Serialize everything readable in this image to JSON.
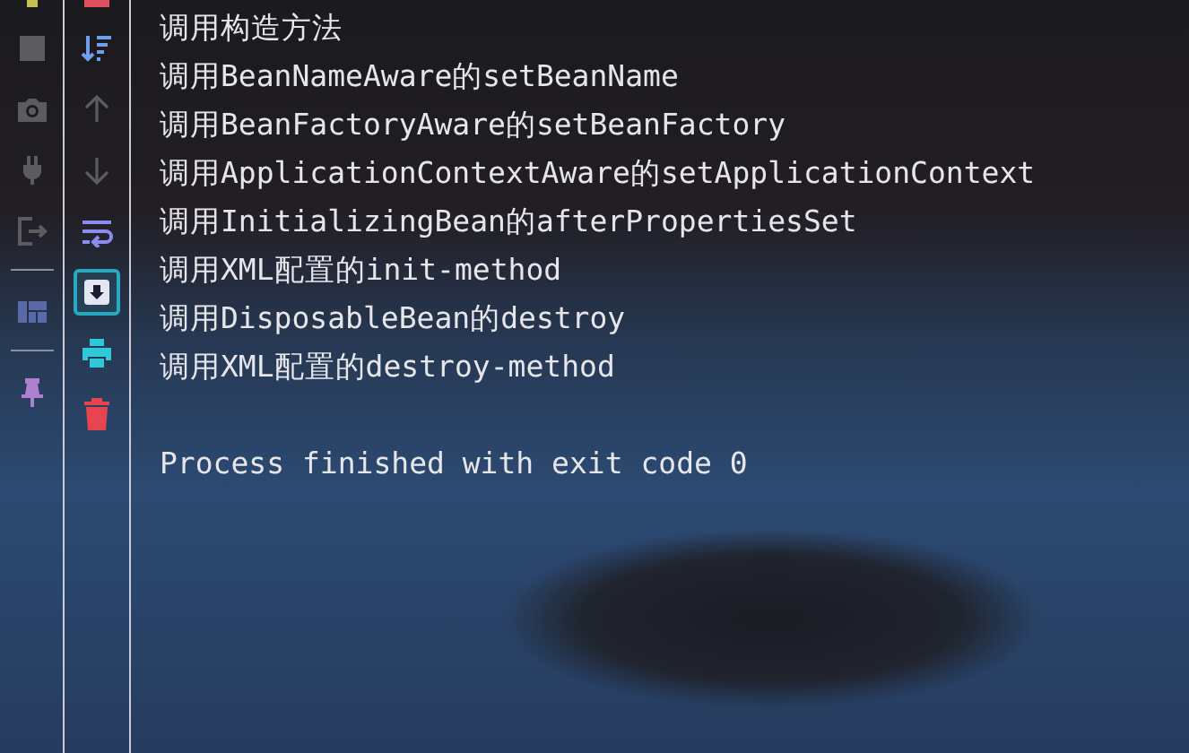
{
  "run_toolbar": [
    {
      "disabled": true
    },
    {
      "disabled": true
    },
    {
      "disabled": true
    },
    {
      "disabled": true
    },
    {
      "disabled": false
    },
    {
      "disabled": false
    }
  ],
  "console_toolbar": [
    {
      "disabled": false,
      "toggled": false
    },
    {
      "disabled": true,
      "toggled": false
    },
    {
      "disabled": true,
      "toggled": false
    },
    {
      "disabled": false,
      "toggled": false
    },
    {
      "disabled": false,
      "toggled": true
    },
    {
      "disabled": false,
      "toggled": false
    },
    {
      "disabled": false,
      "toggled": false
    }
  ],
  "console": {
    "lines": [
      "调用构造方法",
      "调用BeanNameAware的setBeanName",
      "调用BeanFactoryAware的setBeanFactory",
      "调用ApplicationContextAware的setApplicationContext",
      "调用InitializingBean的afterPropertiesSet",
      "调用XML配置的init-method",
      "调用DisposableBean的destroy",
      "调用XML配置的destroy-method"
    ],
    "exit_message": "Process finished with exit code 0"
  }
}
